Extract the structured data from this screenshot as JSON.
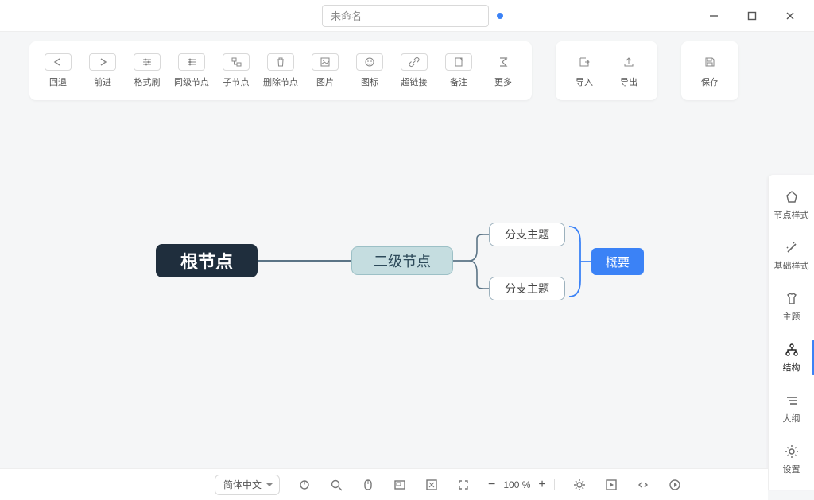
{
  "titlebar": {
    "title": "未命名"
  },
  "toolbar": {
    "undo": "回退",
    "redo": "前进",
    "format_brush": "格式刷",
    "sibling": "同级节点",
    "child": "子节点",
    "delete": "删除节点",
    "image": "图片",
    "icon": "图标",
    "hyperlink": "超链接",
    "note": "备注",
    "more": "更多",
    "import": "导入",
    "export": "导出",
    "save": "保存"
  },
  "sidebar": {
    "node_style": "节点样式",
    "basic_style": "基础样式",
    "theme": "主题",
    "structure": "结构",
    "outline": "大纲",
    "settings": "设置"
  },
  "mindmap": {
    "root": "根节点",
    "level2": "二级节点",
    "branch1": "分支主题",
    "branch2": "分支主题",
    "summary": "概要"
  },
  "bottombar": {
    "language": "简体中文",
    "zoom": "100 %"
  }
}
